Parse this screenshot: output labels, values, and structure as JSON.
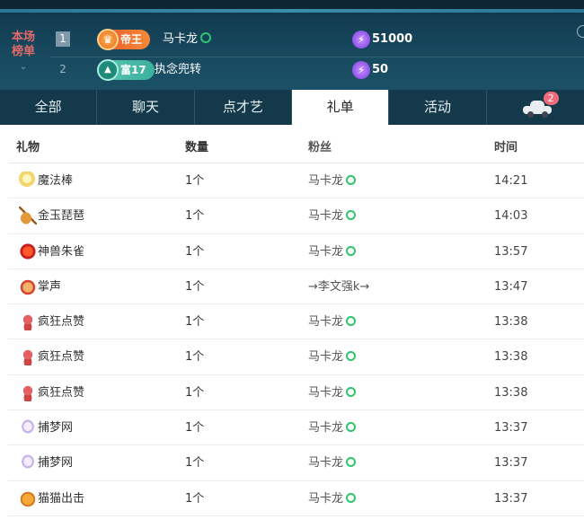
{
  "ranking": {
    "label_line1": "本场",
    "label_line2": "榜单",
    "collapse_glyph": "⌄",
    "entries": [
      {
        "rank": "1",
        "badge_text": "帝王",
        "badge_icon": "crown-icon",
        "name": "马卡龙",
        "score": "51000",
        "score_icon": "lightning-icon"
      },
      {
        "rank": "2",
        "badge_text": "富17",
        "badge_icon": "rich-level-icon",
        "name": "执念兜转",
        "score": "50",
        "score_icon": "lightning-icon"
      }
    ]
  },
  "tabs": [
    {
      "label": "全部",
      "active": false
    },
    {
      "label": "聊天",
      "active": false
    },
    {
      "label": "点才艺",
      "active": false
    },
    {
      "label": "礼单",
      "active": true
    },
    {
      "label": "活动",
      "active": false
    },
    {
      "label": "",
      "icon": "car-icon",
      "badge": "2",
      "active": false
    }
  ],
  "table": {
    "headers": {
      "gift": "礼物",
      "qty": "数量",
      "fan": "粉丝",
      "time": "时间"
    },
    "rows": [
      {
        "gift": "魔法棒",
        "icon": "magic-wand-icon",
        "qty": "1个",
        "fan": "马卡龙",
        "fan_mark": true,
        "time": "14:21"
      },
      {
        "gift": "金玉琵琶",
        "icon": "pipa-icon",
        "qty": "1个",
        "fan": "马卡龙",
        "fan_mark": true,
        "time": "14:03"
      },
      {
        "gift": "神兽朱雀",
        "icon": "vermilion-bird-icon",
        "qty": "1个",
        "fan": "马卡龙",
        "fan_mark": true,
        "time": "13:57"
      },
      {
        "gift": "掌声",
        "icon": "applause-icon",
        "qty": "1个",
        "fan": "→李文强k→",
        "fan_mark": false,
        "time": "13:47"
      },
      {
        "gift": "疯狂点赞",
        "icon": "octopus-icon",
        "qty": "1个",
        "fan": "马卡龙",
        "fan_mark": true,
        "time": "13:38"
      },
      {
        "gift": "疯狂点赞",
        "icon": "octopus-icon",
        "qty": "1个",
        "fan": "马卡龙",
        "fan_mark": true,
        "time": "13:38"
      },
      {
        "gift": "疯狂点赞",
        "icon": "octopus-icon",
        "qty": "1个",
        "fan": "马卡龙",
        "fan_mark": true,
        "time": "13:38"
      },
      {
        "gift": "捕梦网",
        "icon": "dreamcatcher-icon",
        "qty": "1个",
        "fan": "马卡龙",
        "fan_mark": true,
        "time": "13:37"
      },
      {
        "gift": "捕梦网",
        "icon": "dreamcatcher-icon",
        "qty": "1个",
        "fan": "马卡龙",
        "fan_mark": true,
        "time": "13:37"
      },
      {
        "gift": "猫猫出击",
        "icon": "cat-icon",
        "qty": "1个",
        "fan": "马卡龙",
        "fan_mark": true,
        "time": "13:37"
      }
    ]
  },
  "colors": {
    "header_bg": "#17485e",
    "tab_bg": "#13394a",
    "rank_label": "#e26a6a",
    "emperor_badge": "#f58a37",
    "rich_badge": "#3bb09d",
    "verified_mark": "#2fc46d",
    "car_badge": "#f06b7a"
  }
}
